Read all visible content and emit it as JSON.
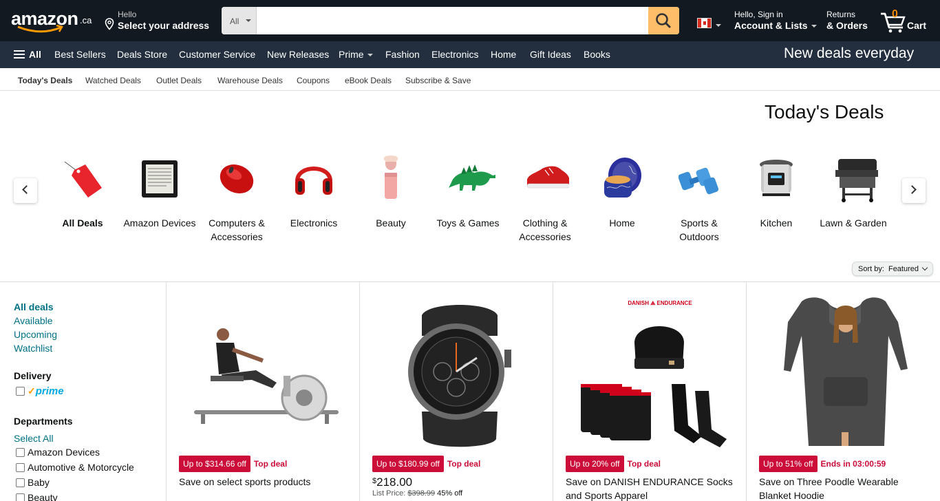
{
  "header": {
    "logo_text": "amazon",
    "logo_tld": ".ca",
    "address_line1": "Hello",
    "address_line2": "Select your address",
    "search_category": "All",
    "search_placeholder": "",
    "account_line1": "Hello, Sign in",
    "account_line2": "Account & Lists",
    "returns_line1": "Returns",
    "returns_line2": "& Orders",
    "cart_count": "0",
    "cart_label": "Cart",
    "accent_color": "#febd69",
    "bg_color": "#131921"
  },
  "subnav": {
    "all_label": "All",
    "items": [
      "Best Sellers",
      "Deals Store",
      "Customer Service",
      "New Releases",
      "Prime",
      "Fashion",
      "Electronics",
      "Home",
      "Gift Ideas",
      "Books"
    ],
    "promo": "New deals everyday",
    "bg_color": "#232f3e"
  },
  "deal_tabs": [
    "Today's Deals",
    "Watched Deals",
    "Outlet Deals",
    "Warehouse Deals",
    "Coupons",
    "eBook Deals",
    "Subscribe & Save"
  ],
  "page_title": "Today's Deals",
  "categories": [
    {
      "label": "All Deals",
      "icon": "tag-icon"
    },
    {
      "label": "Amazon Devices",
      "icon": "kindle-icon"
    },
    {
      "label": "Computers & Accessories",
      "icon": "mouse-icon"
    },
    {
      "label": "Electronics",
      "icon": "headphones-icon"
    },
    {
      "label": "Beauty",
      "icon": "makeup-brush-icon"
    },
    {
      "label": "Toys & Games",
      "icon": "dinosaur-toy-icon"
    },
    {
      "label": "Clothing & Accessories",
      "icon": "sneaker-icon"
    },
    {
      "label": "Home",
      "icon": "candle-icon"
    },
    {
      "label": "Sports & Outdoors",
      "icon": "dumbbell-icon"
    },
    {
      "label": "Kitchen",
      "icon": "pressure-cooker-icon"
    },
    {
      "label": "Lawn & Garden",
      "icon": "grill-icon"
    }
  ],
  "sort": {
    "label": "Sort by:",
    "value": "Featured"
  },
  "sidebar": {
    "deal_filters": [
      "All deals",
      "Available",
      "Upcoming",
      "Watchlist"
    ],
    "delivery_heading": "Delivery",
    "prime_label": "prime",
    "departments_heading": "Departments",
    "select_all": "Select All",
    "departments": [
      "Amazon Devices",
      "Automotive & Motorcycle",
      "Baby",
      "Beauty"
    ]
  },
  "products": [
    {
      "badge": "Up to $314.66 off",
      "badge_note": "Top deal",
      "title": "Save on select sports products",
      "image": "rowing-machine-image"
    },
    {
      "badge": "Up to $180.99 off",
      "badge_note": "Top deal",
      "price_symbol": "$",
      "price": "218.00",
      "list_label": "List Price:",
      "list_price": "$398.99",
      "discount": "45% off",
      "image": "smartwatch-image"
    },
    {
      "badge": "Up to 20% off",
      "badge_note": "Top deal",
      "title": "Save on DANISH ENDURANCE Socks and Sports Apparel",
      "brand": "DANISH ENDURANCE",
      "image": "socks-apparel-image"
    },
    {
      "badge": "Up to 51% off",
      "badge_note": "Ends in 03:00:59",
      "title": "Save on Three Poodle Wearable Blanket Hoodie",
      "image": "blanket-hoodie-image"
    }
  ],
  "colors": {
    "deal_red": "#cc0c39",
    "link_teal": "#007185"
  }
}
